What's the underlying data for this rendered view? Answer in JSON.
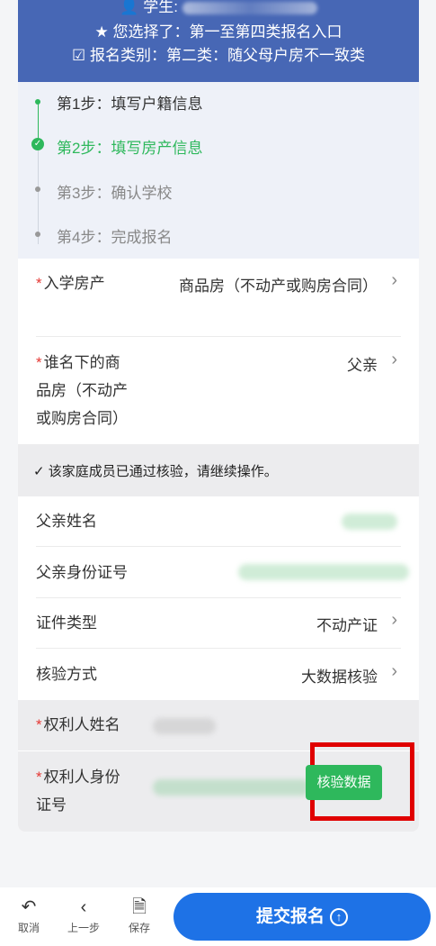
{
  "header": {
    "student_label": "学生:",
    "selected_entry": "您选择了：第一至第四类报名入口",
    "category": "报名类别：第二类：随父母户房不一致类"
  },
  "steps": [
    {
      "label": "第1步：填写户籍信息",
      "state": "done"
    },
    {
      "label": "第2步：填写房产信息",
      "state": "active"
    },
    {
      "label": "第3步：确认学校",
      "state": "todo"
    },
    {
      "label": "第4步：完成报名",
      "state": "todo"
    }
  ],
  "form": {
    "property_label": "入学房产",
    "property_value": "商品房（不动产或购房合同）",
    "owner_label_line1": "谁名下的商",
    "owner_label_line2": "品房（不动产",
    "owner_label_line3": "或购房合同）",
    "owner_value": "父亲",
    "notice": "该家庭成员已通过核验，请继续操作。",
    "father_name_label": "父亲姓名",
    "father_id_label": "父亲身份证号",
    "doc_type_label": "证件类型",
    "doc_type_value": "不动产证",
    "verify_method_label": "核验方式",
    "verify_method_value": "大数据核验",
    "right_holder_name_label": "权利人姓名",
    "right_holder_id_label_line1": "权利人身份",
    "right_holder_id_label_line2": "证号",
    "verify_button": "核验数据"
  },
  "toolbar": {
    "cancel": "取消",
    "previous": "上一步",
    "save": "保存",
    "submit": "提交报名"
  }
}
